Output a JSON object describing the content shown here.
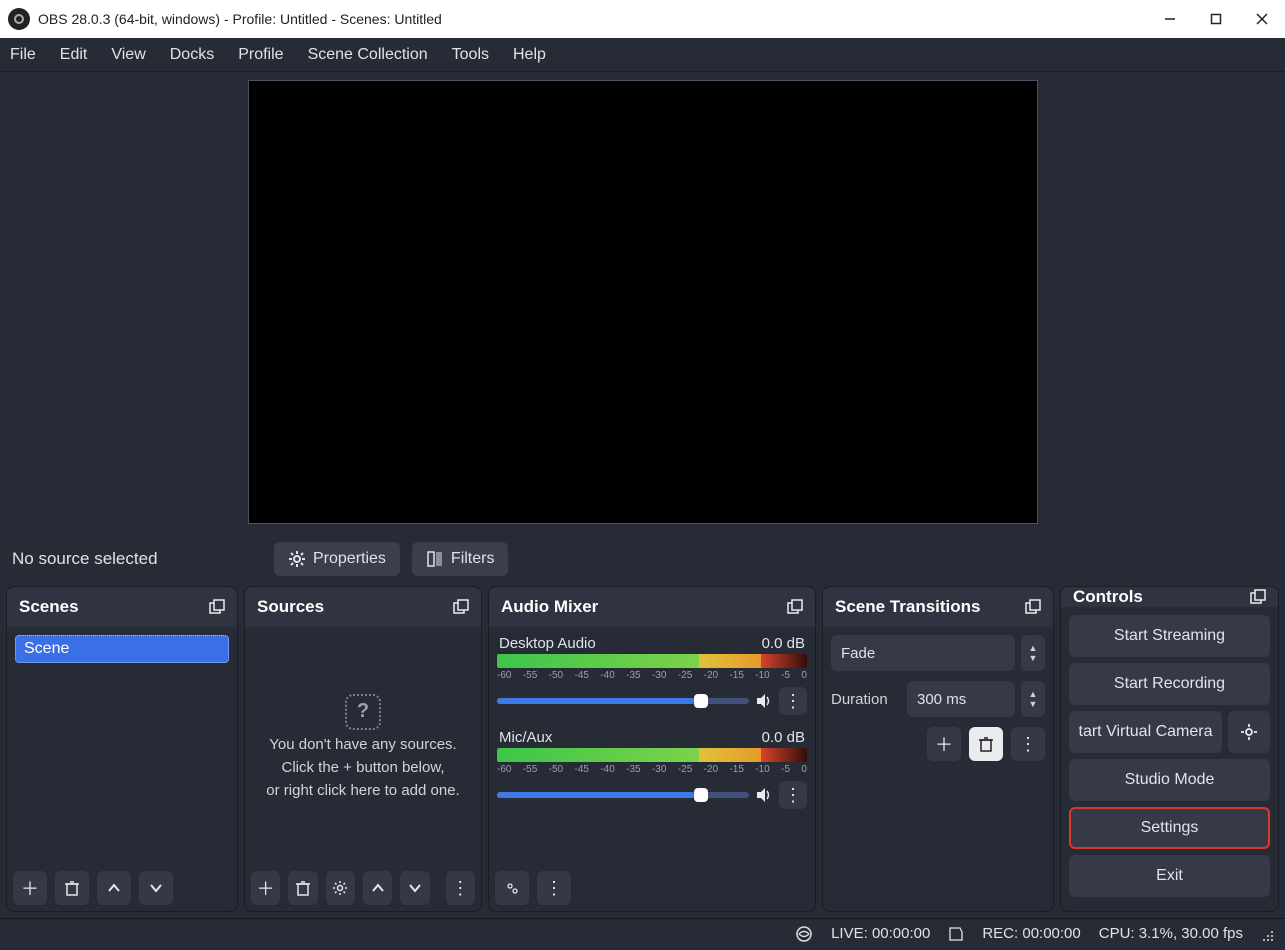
{
  "window": {
    "title": "OBS 28.0.3 (64-bit, windows) - Profile: Untitled - Scenes: Untitled"
  },
  "menu": [
    "File",
    "Edit",
    "View",
    "Docks",
    "Profile",
    "Scene Collection",
    "Tools",
    "Help"
  ],
  "sourcebar": {
    "label": "No source selected",
    "properties": "Properties",
    "filters": "Filters"
  },
  "panels": {
    "scenes": {
      "title": "Scenes",
      "items": [
        "Scene"
      ]
    },
    "sources": {
      "title": "Sources",
      "placeholder_l1": "You don't have any sources.",
      "placeholder_l2": "Click the + button below,",
      "placeholder_l3": "or right click here to add one."
    },
    "mixer": {
      "title": "Audio Mixer",
      "ticks": [
        "-60",
        "-55",
        "-50",
        "-45",
        "-40",
        "-35",
        "-30",
        "-25",
        "-20",
        "-15",
        "-10",
        "-5",
        "0"
      ],
      "channels": [
        {
          "name": "Desktop Audio",
          "level": "0.0 dB"
        },
        {
          "name": "Mic/Aux",
          "level": "0.0 dB"
        }
      ]
    },
    "transitions": {
      "title": "Scene Transitions",
      "selected": "Fade",
      "duration_label": "Duration",
      "duration_value": "300 ms"
    },
    "controls": {
      "title": "Controls",
      "buttons": {
        "stream": "Start Streaming",
        "record": "Start Recording",
        "vcam": "tart Virtual Camera",
        "studio": "Studio Mode",
        "settings": "Settings",
        "exit": "Exit"
      }
    }
  },
  "statusbar": {
    "live": "LIVE: 00:00:00",
    "rec": "REC: 00:00:00",
    "cpu": "CPU: 3.1%, 30.00 fps"
  }
}
